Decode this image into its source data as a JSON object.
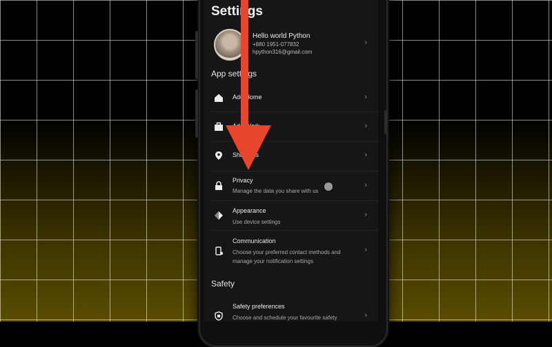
{
  "header": {
    "title": "Settings"
  },
  "profile": {
    "name": "Hello world Python",
    "phone": "+880 1951-077832",
    "email": "hpython316@gmail.com"
  },
  "sections": {
    "app_settings": "App settings",
    "safety": "Safety"
  },
  "rows": {
    "add_home": {
      "label": "Add Home",
      "icon": "home-icon"
    },
    "add_work": {
      "label": "Add Work",
      "icon": "briefcase-icon"
    },
    "shortcuts": {
      "label": "Shortcuts",
      "icon": "location-pin-icon"
    },
    "privacy": {
      "label": "Privacy",
      "sub": "Manage the data you share with us",
      "icon": "lock-icon"
    },
    "appearance": {
      "label": "Appearance",
      "sub": "Use device settings",
      "icon": "diamond-icon"
    },
    "communication": {
      "label": "Communication",
      "sub": "Choose your preferred contact methods and manage your notification settings",
      "icon": "phone-settings-icon"
    },
    "safety_preferences": {
      "label": "Safety preferences",
      "sub": "Choose and schedule your favourite safety",
      "icon": "shield-icon"
    }
  },
  "chevron": "›",
  "colors": {
    "arrow": "#e8452c",
    "screen": "#161616",
    "grid": "#ffffff"
  }
}
